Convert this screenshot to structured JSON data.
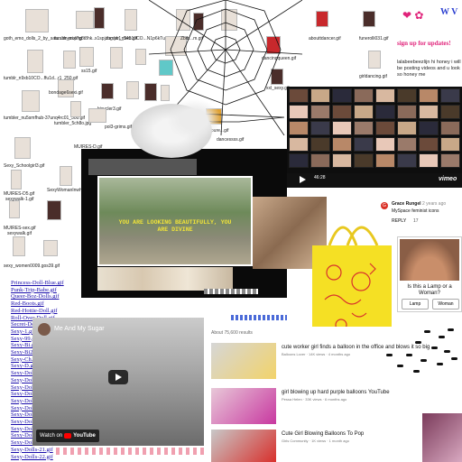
{
  "gif_tiles": [
    {
      "caption": "goth_emo_dolls_2_by_satu...imesi.png"
    },
    {
      "caption": "tumblr_mxl7g8t8hk..x1spjzhg.yo1_540.gif"
    },
    {
      "caption": "tumblr_n9xb10CO...N1p6kTu_r1_540.gif"
    },
    {
      "caption": "tumblr_n9xb10CO...ffu1d...r1_250.gif"
    },
    {
      "caption": "ss15.gif"
    },
    {
      "caption": "bondage6sexi.gif"
    },
    {
      "caption": "bicycler3.gif"
    },
    {
      "caption": "tumbler_nu5smfhub-37unq4rc01_500.gif"
    },
    {
      "caption": "tumbler_5ch8o.jpg"
    },
    {
      "caption": "pol3-grims.gif"
    },
    {
      "caption": "Sexy_Schoolgirl3.gif"
    },
    {
      "caption": "SexyWomanInwhitebikini.gif"
    },
    {
      "caption": "MUIRES-D5.gif"
    },
    {
      "caption": "sexywalk-1.gif"
    },
    {
      "caption": "MUIRES-sex.gif"
    },
    {
      "caption": "sexywalk.gif"
    },
    {
      "caption": "sexy_women0009.gos39.gif"
    },
    {
      "caption": "dancessss.gif"
    },
    {
      "caption": "MUIRES-D.gif"
    },
    {
      "caption": "Zbm...m.gif"
    },
    {
      "caption": "abouttdancer.gif"
    },
    {
      "caption": "funerolli031.gif"
    },
    {
      "caption": "dancingqueen.gif"
    },
    {
      "caption": "girldancing.gif"
    },
    {
      "caption": "xxl_sexy.gif"
    },
    {
      "caption": "Adapure...gif"
    }
  ],
  "signup": {
    "text": "sign up for updates!",
    "wv": "W V"
  },
  "promo_text": "lalabeebeezlijn hi honey i will be posting videos and u look so honey me",
  "video_caption": "YOU ARE LOOKING BEAUTIFULLY, YOU ARE DIVINE",
  "vimeo": {
    "logo": "vimeo",
    "time": "46:28"
  },
  "comment": {
    "user": "Grace Rungel",
    "time": "2 years ago",
    "text": "MySpace feminist icons",
    "reply": "REPLY",
    "likes": "17"
  },
  "ad": {
    "question": "Is this a Lamp or a Woman?",
    "btn_lamp": "Lamp",
    "btn_woman": "Woman"
  },
  "youtube_player": {
    "title": "Me And My Sugar",
    "watch_on": "Watch on",
    "brand": "YouTube"
  },
  "search": {
    "about": "About 75,600 results",
    "results": [
      {
        "title": "cute worker girl finds a balloon in the office and blows it so big",
        "meta": "Balloons Lover · 14K views · 4 months ago"
      },
      {
        "title": "girl blowing up hard purple balloons YouTube",
        "meta": "Pessa Helen · 33K views · 6 months ago"
      },
      {
        "title": "Cute Girl Blowing Balloons To Pop",
        "meta": "Girls Community · 1K views · 1 month ago"
      }
    ]
  },
  "doll_links": [
    "Princess-Doll-Blue.gif",
    "Punk-Trip-Babe.gif",
    "Queer-Boz-Dolls.gif",
    "Red-Boots.gif",
    "Red-Hottie-Doll.gif",
    "Roll-Over-Doll.gif",
    "Secret-Doll.gif",
    "Sexy-1.gif",
    "Sexy-99.gif",
    "Sexy-Bi.gif",
    "Sexy-Bi2.gif",
    "Sexy-Ch.gif",
    "Sexy-D.gif",
    "Sexy-Doll.gif",
    "Sexy-Doll2.gif",
    "Sexy-Doll3.gif",
    "Sexy-Doll4.gif",
    "Sexy-Doll5.gif",
    "Sexy-Doll6.gif",
    "Sexy-Doll7.gif",
    "Sexy-Doll8.gif",
    "Sexy-Doll9.gif",
    "Sexy-Dolls-Bree.gif",
    "Sexy-Dolls-20.gif",
    "Sexy-Dolls-21.gif",
    "Sexy-Dolls-22.gif"
  ],
  "colors": {
    "link": "#1a0dab",
    "signup_pink": "#e0227a",
    "bag_yellow": "#f5e024",
    "bag_red": "#d8302c"
  }
}
